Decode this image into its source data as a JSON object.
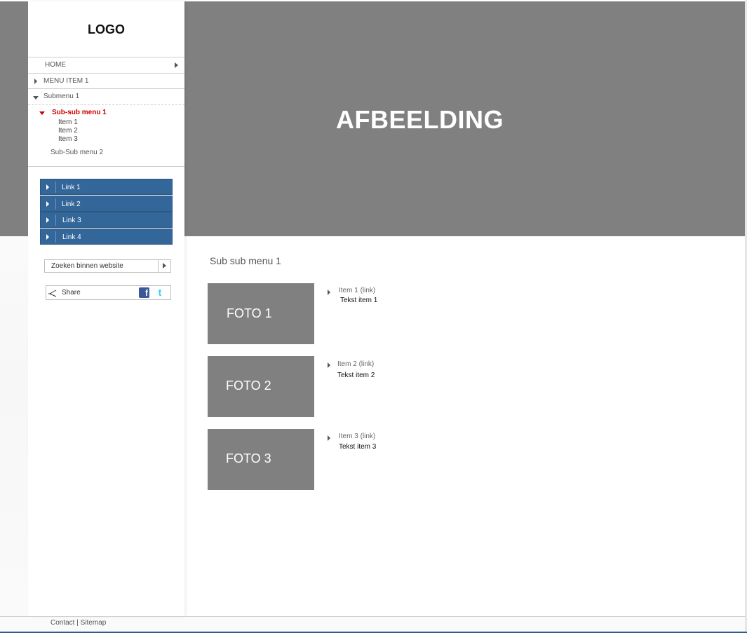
{
  "logo": {
    "text": "LOGO"
  },
  "hero": {
    "title": "AFBEELDING"
  },
  "nav": {
    "home": "HOME",
    "menu_item_1": "MENU ITEM 1",
    "submenu_1": "Submenu 1",
    "subsub_menu_1": "Sub-sub menu 1",
    "subsub_items": [
      "Item 1",
      "Item 2",
      "Item 3"
    ],
    "subsub_menu_2": "Sub-Sub menu 2"
  },
  "links": [
    "Link 1",
    "Link 2",
    "Link 3",
    "Link 4"
  ],
  "search": {
    "placeholder": "Zoeken binnen website"
  },
  "share": {
    "label": "Share"
  },
  "content": {
    "title": "Sub sub menu 1",
    "items": [
      {
        "photo": "FOTO 1",
        "link": "Item 1 (link)",
        "text": "Tekst item 1"
      },
      {
        "photo": "FOTO 2",
        "link": "Item 2 (link)",
        "text": "Tekst item 2"
      },
      {
        "photo": "FOTO 3",
        "link": "Item 3 (link)",
        "text": "Tekst item 3"
      }
    ]
  },
  "footer": {
    "contact": "Contact",
    "separator": "|",
    "sitemap": "Sitemap"
  },
  "colors": {
    "hero": "#808080",
    "link_button": "#336699",
    "active": "#cc0000"
  }
}
